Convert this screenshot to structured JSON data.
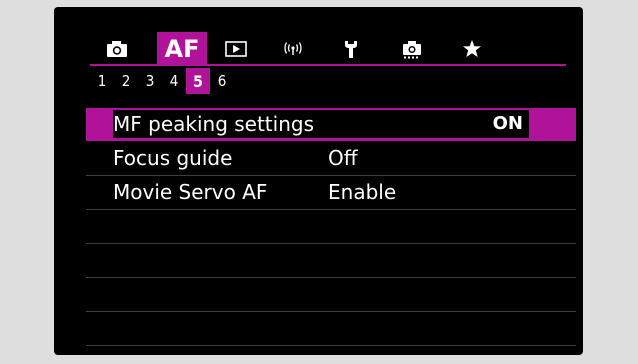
{
  "tabs": [
    {
      "icon": "camera-icon"
    },
    {
      "label": "AF",
      "active": true
    },
    {
      "icon": "playback-icon"
    },
    {
      "icon": "wireless-icon"
    },
    {
      "icon": "wrench-icon"
    },
    {
      "icon": "custom-mode-icon"
    },
    {
      "icon": "star-icon"
    }
  ],
  "pages": [
    "1",
    "2",
    "3",
    "4",
    "5",
    "6"
  ],
  "active_page": "5",
  "menu": {
    "items": [
      {
        "label": "MF peaking settings",
        "value": "ON",
        "selected": true
      },
      {
        "label": "Focus guide",
        "value": "Off"
      },
      {
        "label": "Movie Servo AF",
        "value": "Enable"
      }
    ]
  },
  "colors": {
    "accent": "#b0139a",
    "background": "#000000",
    "text": "#ffffff"
  }
}
